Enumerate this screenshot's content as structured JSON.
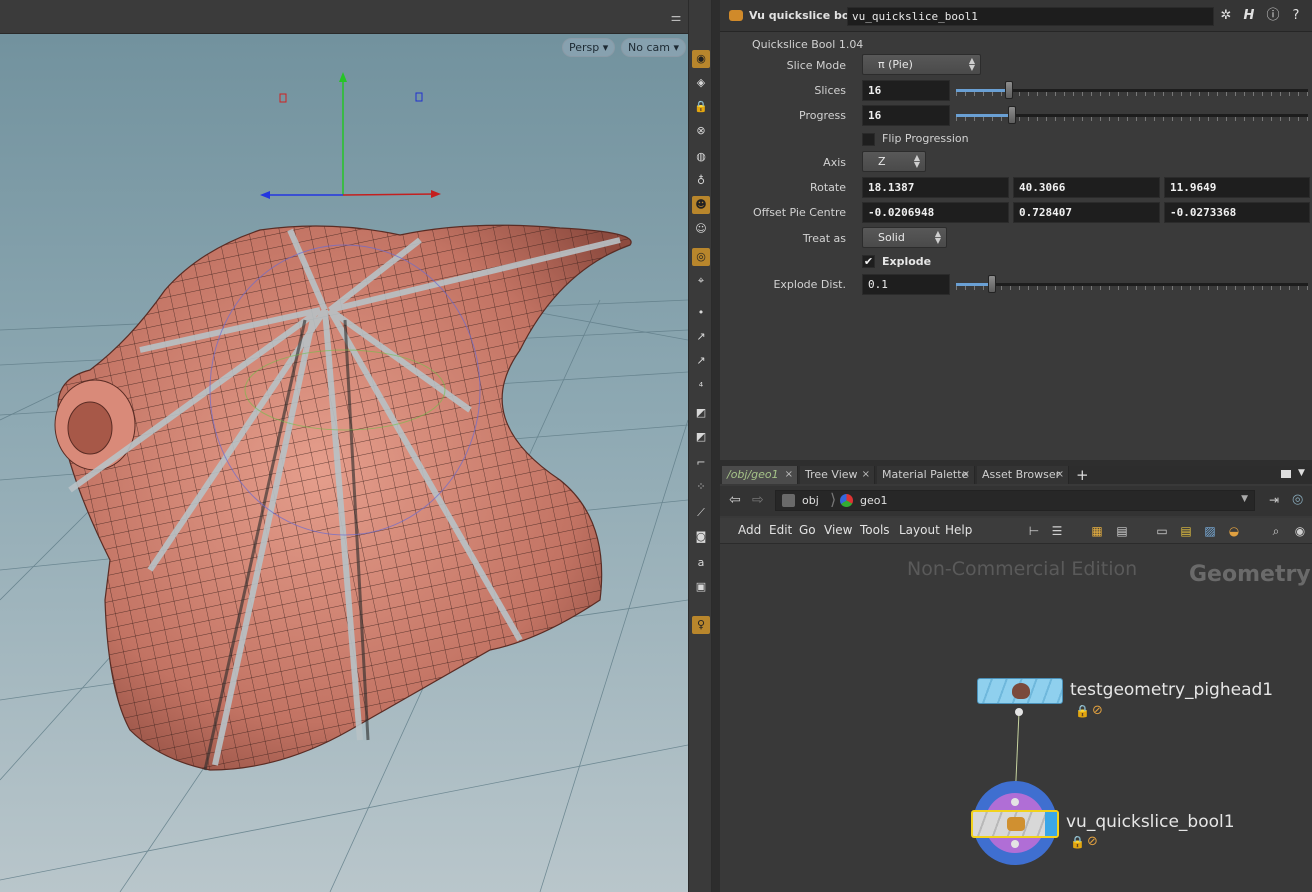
{
  "viewport": {
    "persp_label": "Persp ▾",
    "cam_label": "No cam ▾"
  },
  "params": {
    "node_type": "Vu quickslice bool",
    "node_name": "vu_quickslice_bool1",
    "version": "Quickslice Bool 1.04",
    "slice_mode": {
      "label": "Slice Mode",
      "value": "π (Pie)"
    },
    "slices": {
      "label": "Slices",
      "value": "16"
    },
    "progress": {
      "label": "Progress",
      "value": "16"
    },
    "flip": {
      "label": "Flip Progression",
      "checked": false
    },
    "axis": {
      "label": "Axis",
      "value": "Z"
    },
    "rotate": {
      "label": "Rotate",
      "x": "18.1387",
      "y": "40.3066",
      "z": "11.9649"
    },
    "offset": {
      "label": "Offset Pie Centre",
      "x": "-0.0206948",
      "y": "0.728407",
      "z": "-0.0273368"
    },
    "treat_as": {
      "label": "Treat as",
      "value": "Solid"
    },
    "explode": {
      "label": "Explode",
      "checked": true
    },
    "explode_dist": {
      "label": "Explode Dist.",
      "value": "0.1"
    }
  },
  "network": {
    "tabs": [
      {
        "label": "/obj/geo1"
      },
      {
        "label": "Tree View"
      },
      {
        "label": "Material Palette"
      },
      {
        "label": "Asset Browser"
      }
    ],
    "path": [
      "obj",
      "geo1"
    ],
    "menu": [
      "Add",
      "Edit",
      "Go",
      "View",
      "Tools",
      "Layout",
      "Help"
    ],
    "watermark": "Non-Commercial Edition",
    "context": "Geometry",
    "nodes": [
      {
        "name": "testgeometry_pighead1"
      },
      {
        "name": "vu_quickslice_bool1"
      }
    ]
  },
  "colors": {
    "accent": "#b8862c",
    "selected_node": "#f2d21c",
    "node_blue": "#8fd0ee"
  }
}
